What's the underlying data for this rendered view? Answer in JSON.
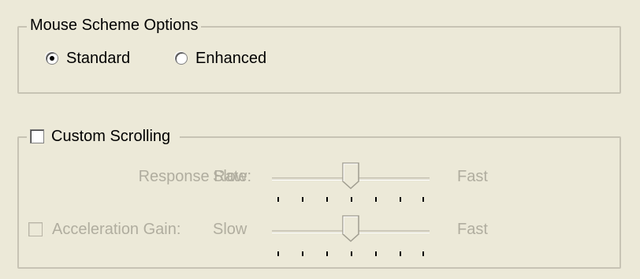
{
  "mouse_scheme": {
    "legend": "Mouse Scheme Options",
    "options": [
      {
        "label": "Standard",
        "selected": true
      },
      {
        "label": "Enhanced",
        "selected": false
      }
    ]
  },
  "custom_scrolling": {
    "label": "Custom Scrolling",
    "checked": false,
    "response_rate": {
      "label": "Response Rate:",
      "slow_label": "Slow",
      "fast_label": "Fast",
      "value": 0.5,
      "enabled": false
    },
    "acceleration_gain": {
      "label": "Acceleration Gain:",
      "slow_label": "Slow",
      "fast_label": "Fast",
      "value": 0.5,
      "checked": false,
      "enabled": false
    }
  },
  "colors": {
    "background": "#ece9d8",
    "disabled_text": "#b0ad9f"
  }
}
